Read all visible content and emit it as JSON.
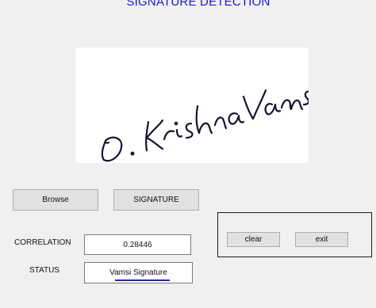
{
  "window": {
    "title": "SIGNATURE DETECTION"
  },
  "image": {
    "signature_text": "D. KrishnaVamsi"
  },
  "buttons": {
    "browse": "Browse",
    "signature": "SIGNATURE",
    "clear": "clear",
    "exit": "exit"
  },
  "results": {
    "correlation_label": "CORRELATION",
    "correlation_value": "0.28446",
    "status_label": "STATUS",
    "status_value": "Vamsi Signature"
  },
  "colors": {
    "title": "#1919d6",
    "background": "#f0f0f0",
    "ink": "#111133"
  }
}
